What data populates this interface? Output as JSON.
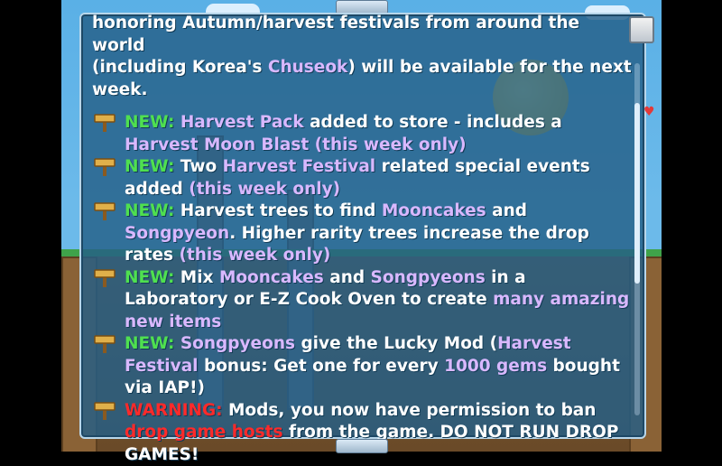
{
  "colors": {
    "highlight_purple": "#d9b8ff",
    "highlight_green": "#4fe04f",
    "warning_red": "#ff2a2a",
    "panel_bg": "#245f87",
    "text": "#ffffff"
  },
  "intro": {
    "line1": "honoring Autumn/harvest festivals from around the world",
    "line2a": "(including Korea's ",
    "chuseok": "Chuseok",
    "line2b": ") will be available for the next",
    "line3": "week."
  },
  "items": [
    {
      "icon": "signpost-icon",
      "tag": "NEW:",
      "p1": " ",
      "h1": "Harvest Pack",
      "p2": " added to store - includes a ",
      "h2": "Harvest Moon Blast",
      "p3": " ",
      "h3": "(this week only)"
    },
    {
      "icon": "signpost-icon",
      "tag": "NEW:",
      "p1": " Two ",
      "h1": "Harvest Festival",
      "p2": " related special events added ",
      "h2": "(this week only)"
    },
    {
      "icon": "signpost-icon",
      "tag": "NEW:",
      "p1": " Harvest trees to find ",
      "h1": "Mooncakes",
      "p2": " and ",
      "h2": "Songpyeon",
      "p3": ". Higher rarity trees increase the drop rates ",
      "h3": "(this week only)"
    },
    {
      "icon": "signpost-icon",
      "tag": "NEW:",
      "p1": " Mix ",
      "h1": "Mooncakes",
      "p2": " and ",
      "h2": "Songpyeons",
      "p3": " in a Laboratory or E-Z Cook Oven to create ",
      "h3": "many amazing new items"
    },
    {
      "icon": "signpost-icon",
      "tag": "NEW:",
      "p1": " ",
      "h1": "Songpyeons",
      "p2": " give the Lucky Mod (",
      "h2": "Harvest Festival",
      "p3": " bonus: Get one for every ",
      "h3": "1000 gems",
      "p4": " bought via IAP!)"
    },
    {
      "icon": "signpost-icon",
      "tag": "WARNING:",
      "p1": " Mods, you now have permission to ban ",
      "h1": "drop game hosts",
      "p2": " from the game.  DO NOT RUN DROP GAMES!"
    }
  ]
}
